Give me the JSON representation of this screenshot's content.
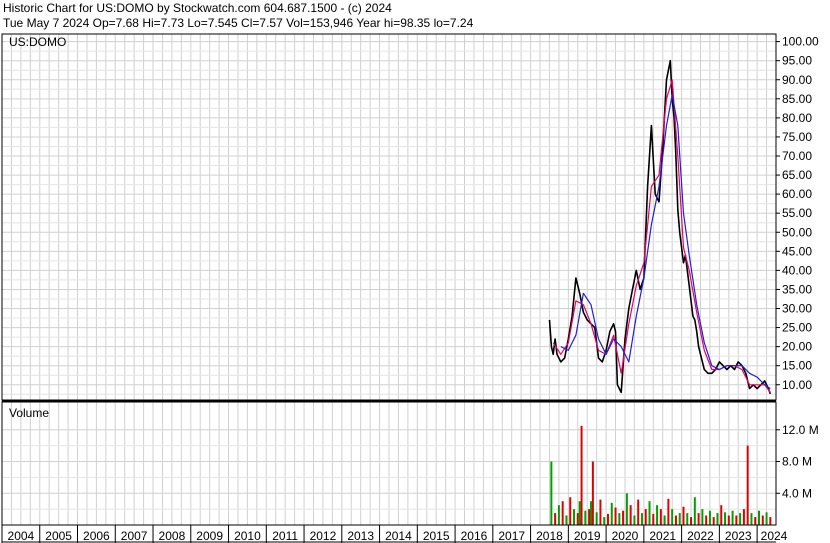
{
  "header": {
    "line1": "Historic Chart for US:DOMO by Stockwatch.com 604.687.1500 - (c) 2024",
    "line2": "Tue May  7 2024   Op=7.68   Hi=7.73   Lo=7.545   Cl=7.57   Vol=153,946   Year hi=98.35   lo=7.24"
  },
  "chart_data": [
    {
      "type": "line",
      "panel": "price",
      "legend_label": "US:DOMO",
      "ylim": [
        6,
        102
      ],
      "y_ticks": [
        "10.00",
        "15.00",
        "20.00",
        "25.00",
        "30.00",
        "35.00",
        "40.00",
        "45.00",
        "50.00",
        "55.00",
        "60.00",
        "65.00",
        "70.00",
        "75.00",
        "80.00",
        "85.00",
        "90.00",
        "95.00",
        "100.00"
      ],
      "x_ticks": [
        "2004",
        "2005",
        "2006",
        "2007",
        "2008",
        "2009",
        "2010",
        "2011",
        "2012",
        "2013",
        "2014",
        "2015",
        "2016",
        "2017",
        "2018",
        "2019",
        "2020",
        "2021",
        "2022",
        "2023",
        "2024"
      ],
      "xlim": [
        2004.0,
        2024.5
      ],
      "grid": true,
      "colors": {
        "price": "#000000",
        "ma_short": "#e8006a",
        "ma_long": "#2020d0",
        "grid": "#d0d0d0"
      },
      "series": [
        {
          "role": "price",
          "x": [
            2018.5,
            2018.55,
            2018.6,
            2018.65,
            2018.7,
            2018.8,
            2018.9,
            2019.0,
            2019.1,
            2019.2,
            2019.3,
            2019.4,
            2019.5,
            2019.6,
            2019.7,
            2019.8,
            2019.9,
            2020.0,
            2020.1,
            2020.2,
            2020.25,
            2020.3,
            2020.4,
            2020.5,
            2020.6,
            2020.7,
            2020.8,
            2020.9,
            2021.0,
            2021.05,
            2021.1,
            2021.15,
            2021.2,
            2021.3,
            2021.4,
            2021.5,
            2021.6,
            2021.7,
            2021.75,
            2021.8,
            2021.85,
            2021.9,
            2021.95,
            2022.0,
            2022.05,
            2022.1,
            2022.15,
            2022.2,
            2022.3,
            2022.35,
            2022.4,
            2022.45,
            2022.5,
            2022.55,
            2022.6,
            2022.7,
            2022.8,
            2022.9,
            2023.0,
            2023.1,
            2023.2,
            2023.3,
            2023.4,
            2023.5,
            2023.6,
            2023.7,
            2023.8,
            2023.9,
            2024.0,
            2024.1,
            2024.2,
            2024.3,
            2024.35
          ],
          "values": [
            27,
            20,
            18,
            22,
            18,
            16,
            17,
            22,
            28,
            38,
            34,
            29,
            27,
            26,
            25,
            17,
            16,
            19,
            24,
            26,
            24,
            10,
            8,
            22,
            30,
            35,
            40,
            35,
            38,
            50,
            62,
            70,
            78,
            60,
            58,
            72,
            90,
            95,
            85,
            80,
            70,
            56,
            50,
            46,
            42,
            44,
            40,
            36,
            28,
            27,
            24,
            20,
            18,
            16,
            14,
            13,
            13,
            14,
            16,
            15,
            14,
            15,
            14,
            16,
            15,
            13,
            9,
            10,
            9,
            10,
            11,
            9,
            7.6
          ]
        },
        {
          "role": "ma_short",
          "x": [
            2018.6,
            2018.8,
            2019.0,
            2019.2,
            2019.4,
            2019.6,
            2019.8,
            2020.0,
            2020.2,
            2020.4,
            2020.6,
            2020.8,
            2021.0,
            2021.2,
            2021.4,
            2021.6,
            2021.75,
            2021.9,
            2022.05,
            2022.2,
            2022.4,
            2022.6,
            2022.8,
            2023.0,
            2023.2,
            2023.4,
            2023.6,
            2023.8,
            2024.0,
            2024.2,
            2024.35
          ],
          "values": [
            21,
            18,
            21,
            32,
            31,
            26,
            19,
            18,
            23,
            13,
            26,
            36,
            42,
            62,
            65,
            85,
            90,
            70,
            46,
            40,
            29,
            19,
            14,
            14,
            15,
            15,
            14,
            10,
            10,
            10,
            8
          ]
        },
        {
          "role": "ma_long",
          "x": [
            2018.8,
            2019.0,
            2019.2,
            2019.4,
            2019.6,
            2019.8,
            2020.0,
            2020.2,
            2020.4,
            2020.6,
            2020.8,
            2021.0,
            2021.2,
            2021.4,
            2021.6,
            2021.75,
            2021.9,
            2022.05,
            2022.2,
            2022.4,
            2022.6,
            2022.8,
            2023.0,
            2023.2,
            2023.4,
            2023.6,
            2023.8,
            2024.0,
            2024.2,
            2024.35
          ],
          "values": [
            20,
            19,
            23,
            34,
            31,
            22,
            18,
            22,
            20,
            16,
            28,
            38,
            52,
            62,
            78,
            86,
            78,
            55,
            44,
            31,
            21,
            15,
            14,
            15,
            15,
            15,
            13,
            12,
            10,
            9
          ]
        }
      ]
    },
    {
      "type": "bar",
      "panel": "volume",
      "legend_label": "Volume",
      "ylim": [
        0,
        15
      ],
      "y_ticks": [
        "4.0 M",
        "8.0 M",
        "12.0 M"
      ],
      "colors": {
        "up": "#00a000",
        "down": "#e00000"
      },
      "x": [
        2018.55,
        2018.65,
        2018.75,
        2018.85,
        2018.95,
        2019.05,
        2019.15,
        2019.25,
        2019.3,
        2019.35,
        2019.45,
        2019.55,
        2019.6,
        2019.65,
        2019.75,
        2019.85,
        2019.95,
        2020.05,
        2020.15,
        2020.25,
        2020.35,
        2020.45,
        2020.55,
        2020.65,
        2020.75,
        2020.85,
        2020.95,
        2021.05,
        2021.15,
        2021.25,
        2021.35,
        2021.45,
        2021.55,
        2021.65,
        2021.75,
        2021.85,
        2021.95,
        2022.05,
        2022.15,
        2022.25,
        2022.35,
        2022.45,
        2022.55,
        2022.65,
        2022.75,
        2022.85,
        2022.95,
        2023.05,
        2023.15,
        2023.25,
        2023.35,
        2023.45,
        2023.55,
        2023.65,
        2023.75,
        2023.85,
        2023.95,
        2024.05,
        2024.15,
        2024.25,
        2024.35
      ],
      "values": [
        8.0,
        1.5,
        2.5,
        3.0,
        1.2,
        3.5,
        2.0,
        1.5,
        3.0,
        12.5,
        1.8,
        2.0,
        3.0,
        8.0,
        1.6,
        3.2,
        1.0,
        1.4,
        2.8,
        2.2,
        1.5,
        1.8,
        4.0,
        2.5,
        1.2,
        3.2,
        1.5,
        2.0,
        3.0,
        1.4,
        2.5,
        2.0,
        1.2,
        3.3,
        2.0,
        1.2,
        1.5,
        2.3,
        1.5,
        1.0,
        3.5,
        1.5,
        2.0,
        1.2,
        1.8,
        1.0,
        1.5,
        2.5,
        1.6,
        1.2,
        1.8,
        1.2,
        1.5,
        2.0,
        10.0,
        1.5,
        1.0,
        1.8,
        1.2,
        1.6,
        1.0
      ],
      "directions": [
        "up",
        "down",
        "up",
        "down",
        "up",
        "down",
        "up",
        "down",
        "up",
        "down",
        "up",
        "down",
        "up",
        "down",
        "up",
        "down",
        "up",
        "down",
        "up",
        "down",
        "up",
        "down",
        "up",
        "down",
        "up",
        "down",
        "up",
        "down",
        "up",
        "down",
        "up",
        "down",
        "up",
        "down",
        "up",
        "down",
        "up",
        "down",
        "up",
        "down",
        "up",
        "down",
        "up",
        "down",
        "up",
        "down",
        "up",
        "down",
        "up",
        "down",
        "up",
        "down",
        "up",
        "down",
        "down",
        "up",
        "down",
        "up",
        "down",
        "up",
        "down"
      ]
    }
  ]
}
